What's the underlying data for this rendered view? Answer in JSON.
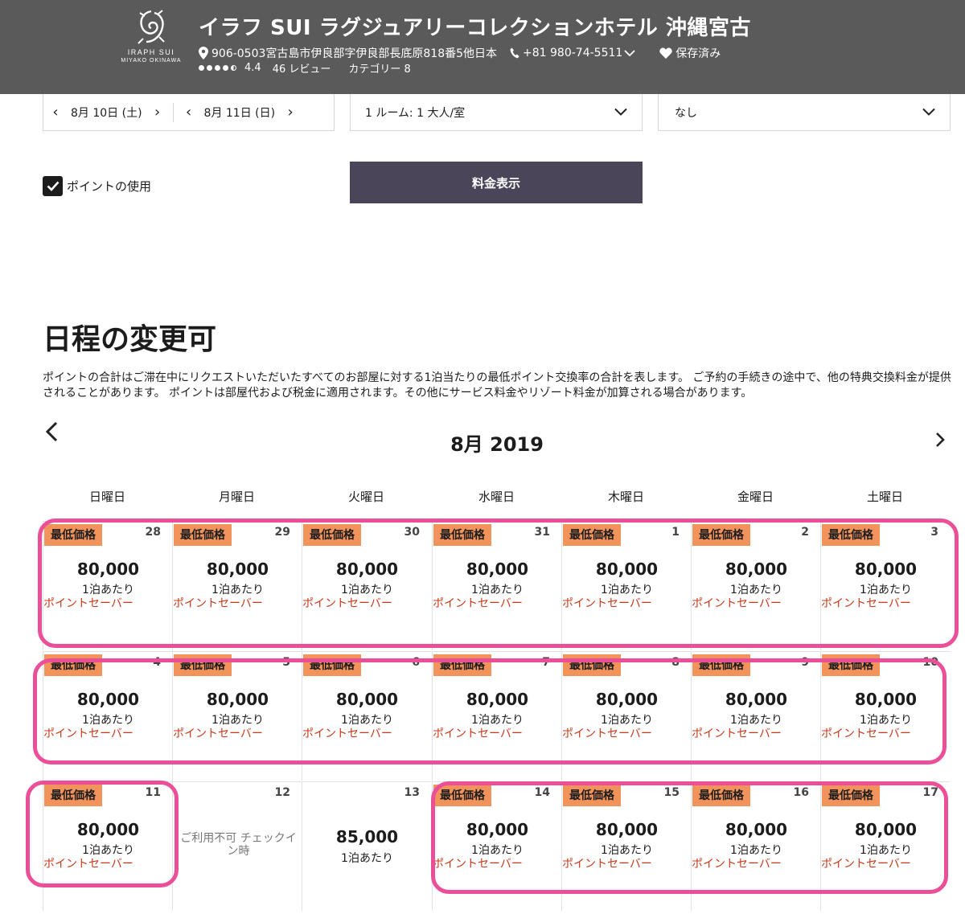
{
  "header": {
    "logo_line1": "IRAPH SUI",
    "logo_line2": "MIYAKO OKINAWA",
    "hotel_name": "イラフ SUI ラグジュアリーコレクションホテル 沖縄宮古",
    "address": "906-0503宮古島市伊良部字伊良部長底原818番5他日本",
    "phone": "+81 980-74-5511",
    "saved": "保存済み",
    "rating": "4.4",
    "reviews": "46 レビュー",
    "category": "カテゴリー 8"
  },
  "search": {
    "checkin": "8月 10日 (土)",
    "checkout": "8月 11日 (日)",
    "rooms": "1 ルーム: 1 大人/室",
    "rate": "なし",
    "use_points": "ポイントの使用",
    "show_rates": "料金表示"
  },
  "calendar": {
    "title": "日程の変更可",
    "note": "ポイントの合計はご滞在中にリクエストいただいたすべてのお部屋に対する1泊当たりの最低ポイント交換率の合計を表します。 ご予約の手続きの途中で、他の特典交換料金が提供されることがあります。 ポイントは部屋代および税金に適用されます。その他にサービス料金やリゾート料金が加算される場合があります。",
    "month": "8月 2019",
    "weekdays": [
      "日曜日",
      "月曜日",
      "火曜日",
      "水曜日",
      "木曜日",
      "金曜日",
      "土曜日"
    ],
    "lowest_badge": "最低価格",
    "per_night": "1泊あたり",
    "saver": "ポイントセーバー",
    "unavailable": "ご利用不可 チェックイン時",
    "weeks": [
      [
        {
          "day": "28",
          "price": "80,000",
          "type": "saver"
        },
        {
          "day": "29",
          "price": "80,000",
          "type": "saver"
        },
        {
          "day": "30",
          "price": "80,000",
          "type": "saver"
        },
        {
          "day": "31",
          "price": "80,000",
          "type": "saver"
        },
        {
          "day": "1",
          "price": "80,000",
          "type": "saver"
        },
        {
          "day": "2",
          "price": "80,000",
          "type": "saver"
        },
        {
          "day": "3",
          "price": "80,000",
          "type": "saver"
        }
      ],
      [
        {
          "day": "4",
          "price": "80,000",
          "type": "saver"
        },
        {
          "day": "5",
          "price": "80,000",
          "type": "saver"
        },
        {
          "day": "6",
          "price": "80,000",
          "type": "saver"
        },
        {
          "day": "7",
          "price": "80,000",
          "type": "saver"
        },
        {
          "day": "8",
          "price": "80,000",
          "type": "saver"
        },
        {
          "day": "9",
          "price": "80,000",
          "type": "saver"
        },
        {
          "day": "10",
          "price": "80,000",
          "type": "saver"
        }
      ],
      [
        {
          "day": "11",
          "price": "80,000",
          "type": "saver"
        },
        {
          "day": "12",
          "price": "",
          "type": "unavailable"
        },
        {
          "day": "13",
          "price": "85,000",
          "type": "plain"
        },
        {
          "day": "14",
          "price": "80,000",
          "type": "saver"
        },
        {
          "day": "15",
          "price": "80,000",
          "type": "saver"
        },
        {
          "day": "16",
          "price": "80,000",
          "type": "saver"
        },
        {
          "day": "17",
          "price": "80,000",
          "type": "saver"
        }
      ]
    ]
  },
  "colors": {
    "header_bg": "#5a5a5a",
    "button_bg": "#4a4559",
    "badge_bg": "#f2935c",
    "saver_text": "#c8391a",
    "highlight": "#ea4f98"
  }
}
